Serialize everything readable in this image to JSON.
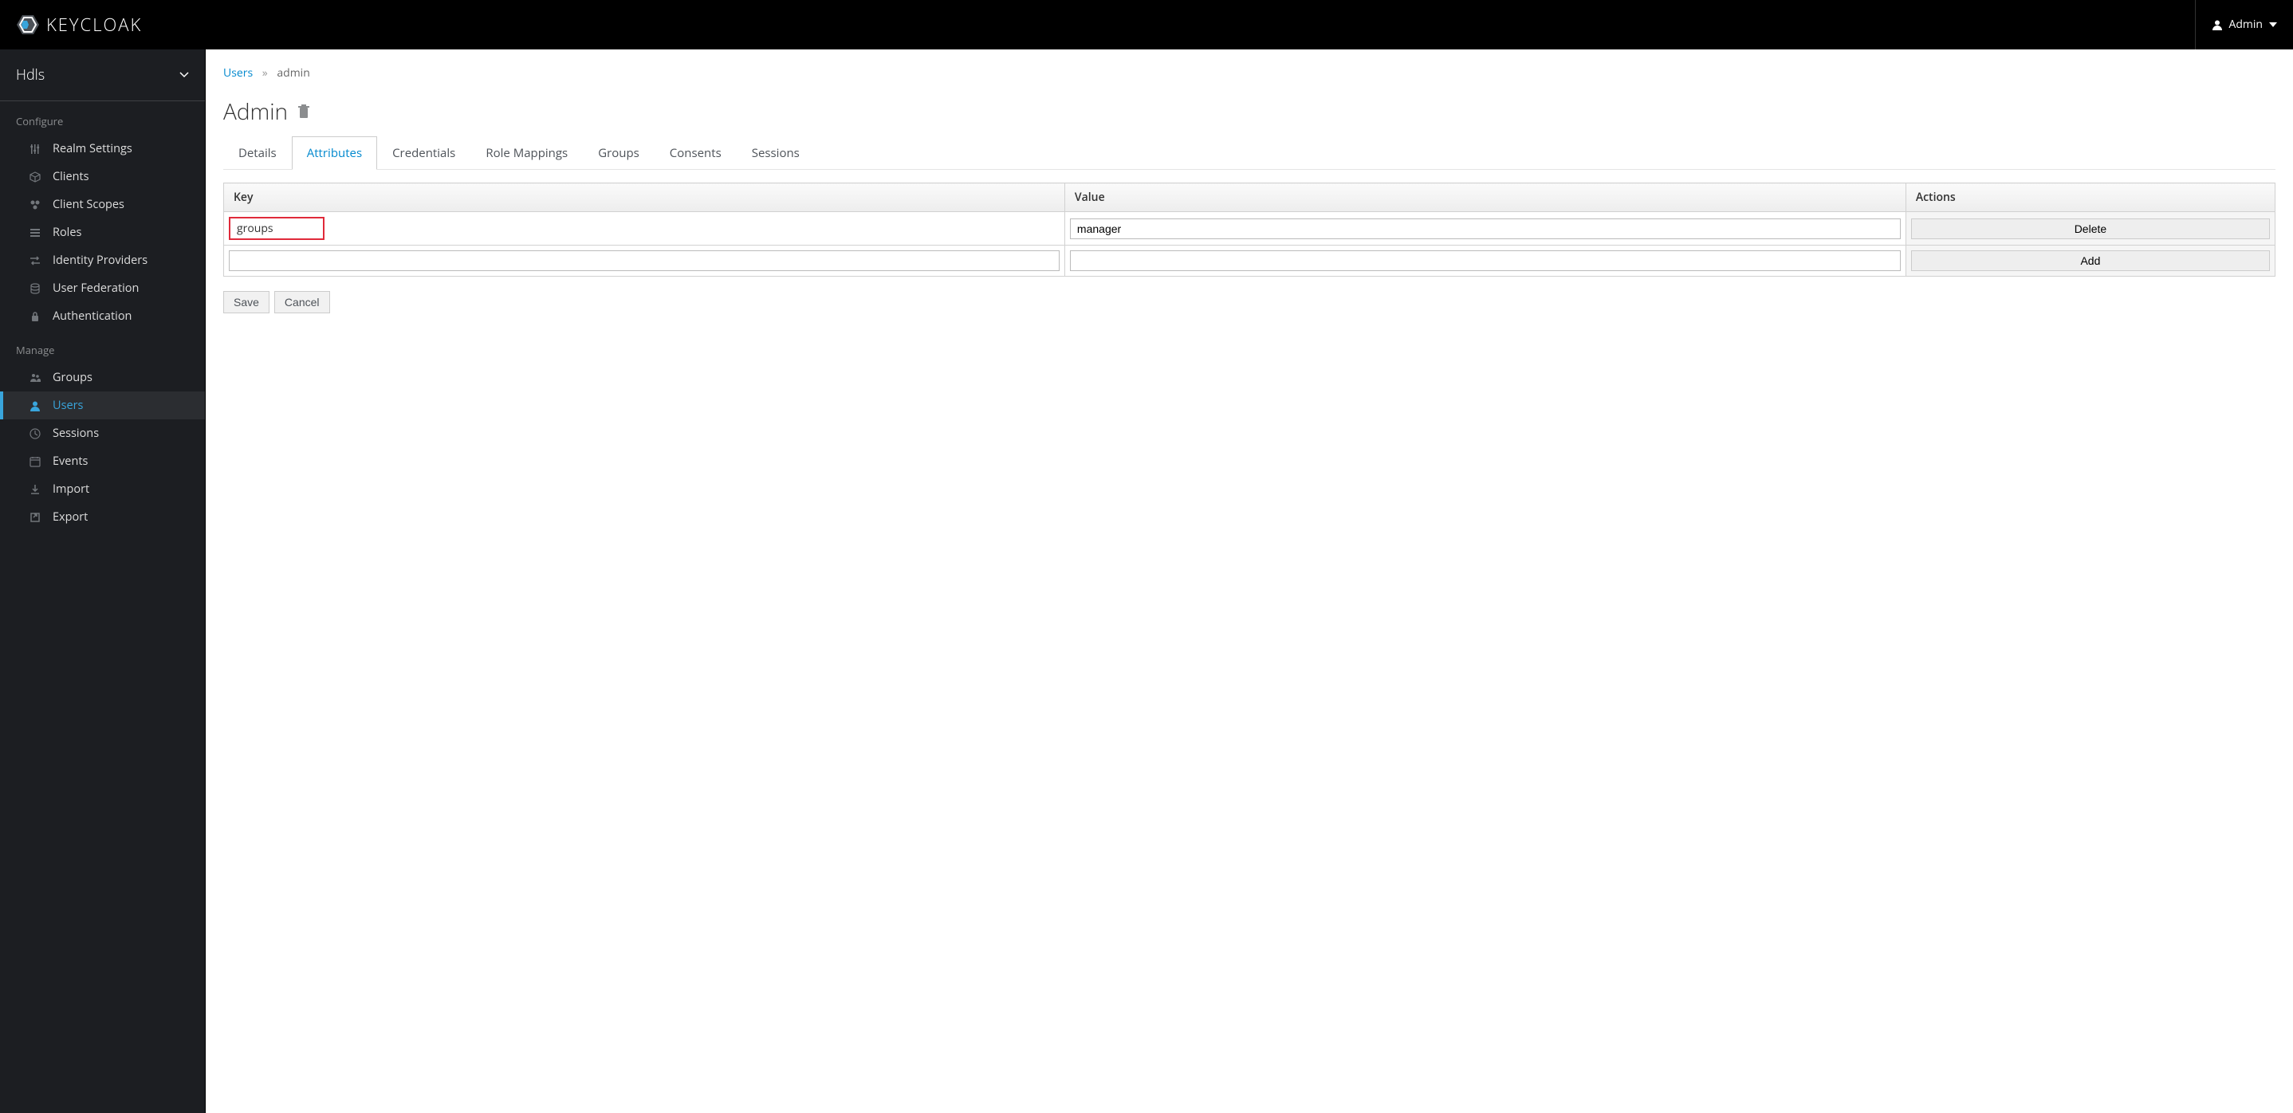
{
  "topbar": {
    "brand": "KEYCLOAK",
    "user_label": "Admin"
  },
  "sidebar": {
    "realm_name": "Hdls",
    "sections": {
      "configure_label": "Configure",
      "manage_label": "Manage"
    },
    "configure": [
      {
        "label": "Realm Settings",
        "icon": "sliders-icon"
      },
      {
        "label": "Clients",
        "icon": "cube-icon"
      },
      {
        "label": "Client Scopes",
        "icon": "scopes-icon"
      },
      {
        "label": "Roles",
        "icon": "list-icon"
      },
      {
        "label": "Identity Providers",
        "icon": "exchange-icon"
      },
      {
        "label": "User Federation",
        "icon": "database-icon"
      },
      {
        "label": "Authentication",
        "icon": "lock-icon"
      }
    ],
    "manage": [
      {
        "label": "Groups",
        "icon": "group-icon",
        "active": false
      },
      {
        "label": "Users",
        "icon": "user-icon",
        "active": true
      },
      {
        "label": "Sessions",
        "icon": "clock-icon",
        "active": false
      },
      {
        "label": "Events",
        "icon": "calendar-icon",
        "active": false
      },
      {
        "label": "Import",
        "icon": "import-icon",
        "active": false
      },
      {
        "label": "Export",
        "icon": "export-icon",
        "active": false
      }
    ]
  },
  "breadcrumb": {
    "parent": "Users",
    "current": "admin"
  },
  "page": {
    "title": "Admin"
  },
  "tabs": [
    {
      "label": "Details",
      "active": false
    },
    {
      "label": "Attributes",
      "active": true
    },
    {
      "label": "Credentials",
      "active": false
    },
    {
      "label": "Role Mappings",
      "active": false
    },
    {
      "label": "Groups",
      "active": false
    },
    {
      "label": "Consents",
      "active": false
    },
    {
      "label": "Sessions",
      "active": false
    }
  ],
  "attributes": {
    "headers": {
      "key": "Key",
      "value": "Value",
      "actions": "Actions"
    },
    "rows": [
      {
        "key": "groups",
        "value": "manager",
        "action": "Delete",
        "highlighted": true
      },
      {
        "key": "",
        "value": "",
        "action": "Add",
        "highlighted": false
      }
    ]
  },
  "form": {
    "save": "Save",
    "cancel": "Cancel"
  }
}
